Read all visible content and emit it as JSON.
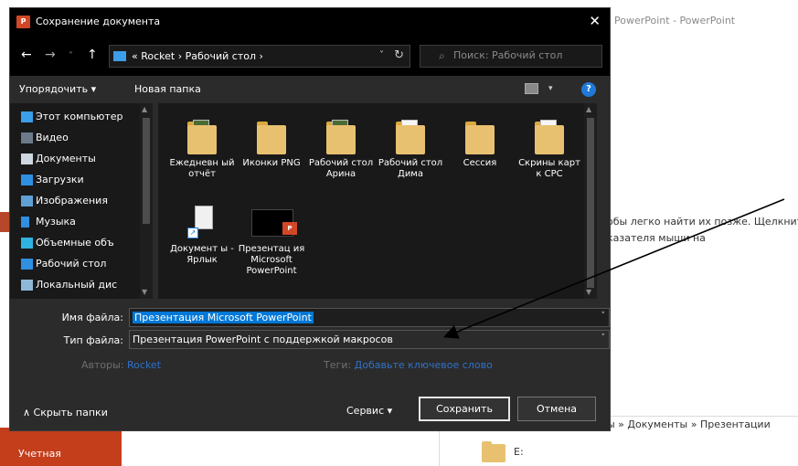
{
  "background": {
    "title": "PowerPoint - PowerPoint",
    "text_line1": "обы легко найти их позже. Щелкните",
    "text_line2": "казателя мыши на",
    "account_label": "Учетная",
    "path_text": "ы » Документы » Презентации",
    "drive_label": "E:"
  },
  "dialog": {
    "app_badge": "P",
    "title": "Сохранение документа",
    "close_glyph": "✕",
    "nav": {
      "back": "←",
      "forward": "→",
      "recent": "˅",
      "up": "↑",
      "address": "« Rocket  ›  Рабочий стол  ›",
      "address_dropdown": "˅",
      "refresh": "↻",
      "search_placeholder": "Поиск: Рабочий стол",
      "search_glyph": "⌕"
    },
    "toolbar": {
      "organize": "Упорядочить ▾",
      "new_folder": "Новая папка",
      "view_chevron": "▾",
      "help": "?"
    },
    "sidebar": {
      "items": [
        {
          "label": "Этот компьютер",
          "icon": "computer-icon",
          "color": "#3c9de8"
        },
        {
          "label": "Видео",
          "icon": "video-icon",
          "color": "#6b7b8c"
        },
        {
          "label": "Документы",
          "icon": "documents-icon",
          "color": "#cfd8e0"
        },
        {
          "label": "Загрузки",
          "icon": "download-icon",
          "color": "#2f8fe0"
        },
        {
          "label": "Изображения",
          "icon": "images-icon",
          "color": "#5fa0d6"
        },
        {
          "label": "Музыка",
          "icon": "music-icon",
          "color": "#2f8fe0"
        },
        {
          "label": "Объемные объ",
          "icon": "3d-objects-icon",
          "color": "#30b3e0"
        },
        {
          "label": "Рабочий стол",
          "icon": "desktop-icon",
          "color": "#2f8fe0"
        },
        {
          "label": "Локальный дис",
          "icon": "local-disk-icon",
          "color": "#8fb8d8"
        }
      ]
    },
    "files": [
      {
        "name": "Ежедневн ый отчёт",
        "icon": "folder-icon"
      },
      {
        "name": "Иконки PNG",
        "icon": "folder-icon"
      },
      {
        "name": "Рабочий стол Арина",
        "icon": "folder-icon"
      },
      {
        "name": "Рабочий стол Дима",
        "icon": "folder-icon"
      },
      {
        "name": "Сессия",
        "icon": "folder-icon"
      },
      {
        "name": "Скрины карт к СРС",
        "icon": "folder-icon"
      },
      {
        "name": "Документ ы - Ярлык",
        "icon": "shortcut-icon"
      },
      {
        "name": "Презентац ия Microsoft PowerPoint",
        "icon": "pptx-icon"
      }
    ],
    "fields": {
      "filename_label": "Имя файла:",
      "filename_value": "Презентация Microsoft PowerPoint",
      "filetype_label": "Тип файла:",
      "filetype_value": "Презентация PowerPoint с поддержкой макросов",
      "authors_label": "Авторы:",
      "authors_value": "Rocket",
      "tags_label": "Теги:",
      "tags_value": "Добавьте ключевое слово"
    },
    "footer": {
      "hide_folders": "∧  Скрыть папки",
      "service": "Сервис   ▾",
      "save": "Сохранить",
      "cancel": "Отмена"
    }
  },
  "colors": {
    "accent": "#0078d7",
    "ppt_orange": "#d24726",
    "dialog_bg": "#2b2b2b",
    "link_blue": "#2e72c8"
  }
}
